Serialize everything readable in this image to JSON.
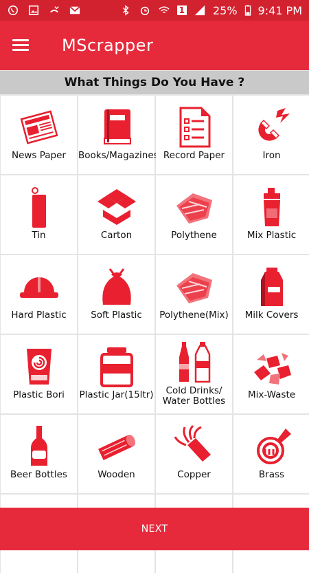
{
  "status_bar": {
    "battery": "25%",
    "time": "9:41 PM",
    "network": "1",
    "icons_left": [
      "whatsapp-icon",
      "image-icon",
      "missed-call-icon",
      "gmail-icon"
    ],
    "icons_right": [
      "bluetooth-icon",
      "alarm-icon",
      "wifi-icon",
      "signal-icon"
    ]
  },
  "app_bar": {
    "title": "MScrapper",
    "menu_icon": "hamburger-menu-icon"
  },
  "subheader": {
    "text": "What Things Do You Have ?"
  },
  "items": [
    {
      "label": "News Paper",
      "icon": "newspaper-icon"
    },
    {
      "label": "Books/Magazines",
      "icon": "book-icon"
    },
    {
      "label": "Record Paper",
      "icon": "document-icon"
    },
    {
      "label": "Iron",
      "icon": "magnet-icon"
    },
    {
      "label": "Tin",
      "icon": "tin-can-icon"
    },
    {
      "label": "Carton",
      "icon": "carton-box-icon"
    },
    {
      "label": "Polythene",
      "icon": "polythene-icon"
    },
    {
      "label": "Mix Plastic",
      "icon": "shaker-bottle-icon"
    },
    {
      "label": "Hard Plastic",
      "icon": "hard-hat-icon"
    },
    {
      "label": "Soft Plastic",
      "icon": "garbage-bag-icon"
    },
    {
      "label": "Polythene(Mix)",
      "icon": "polythene-mix-icon"
    },
    {
      "label": "Milk Covers",
      "icon": "milk-carton-icon"
    },
    {
      "label": "Plastic Bori",
      "icon": "plastic-sack-icon"
    },
    {
      "label": "Plastic Jar(15ltr)",
      "icon": "plastic-jar-icon"
    },
    {
      "label": "Cold Drinks/\nWater Bottles",
      "icon": "bottles-icon"
    },
    {
      "label": "Mix-Waste",
      "icon": "mixed-waste-icon"
    },
    {
      "label": "Beer Bottles",
      "icon": "beer-bottle-icon"
    },
    {
      "label": "Wooden",
      "icon": "wood-log-icon"
    },
    {
      "label": "Copper",
      "icon": "copper-wire-icon"
    },
    {
      "label": "Brass",
      "icon": "brass-horn-icon"
    }
  ],
  "next_button": {
    "label": "NEXT"
  },
  "colors": {
    "primary": "#e62a3c",
    "status_bar": "#d3222f",
    "icon_red": "#e8202f",
    "subheader_bg": "#c9c9c9"
  }
}
